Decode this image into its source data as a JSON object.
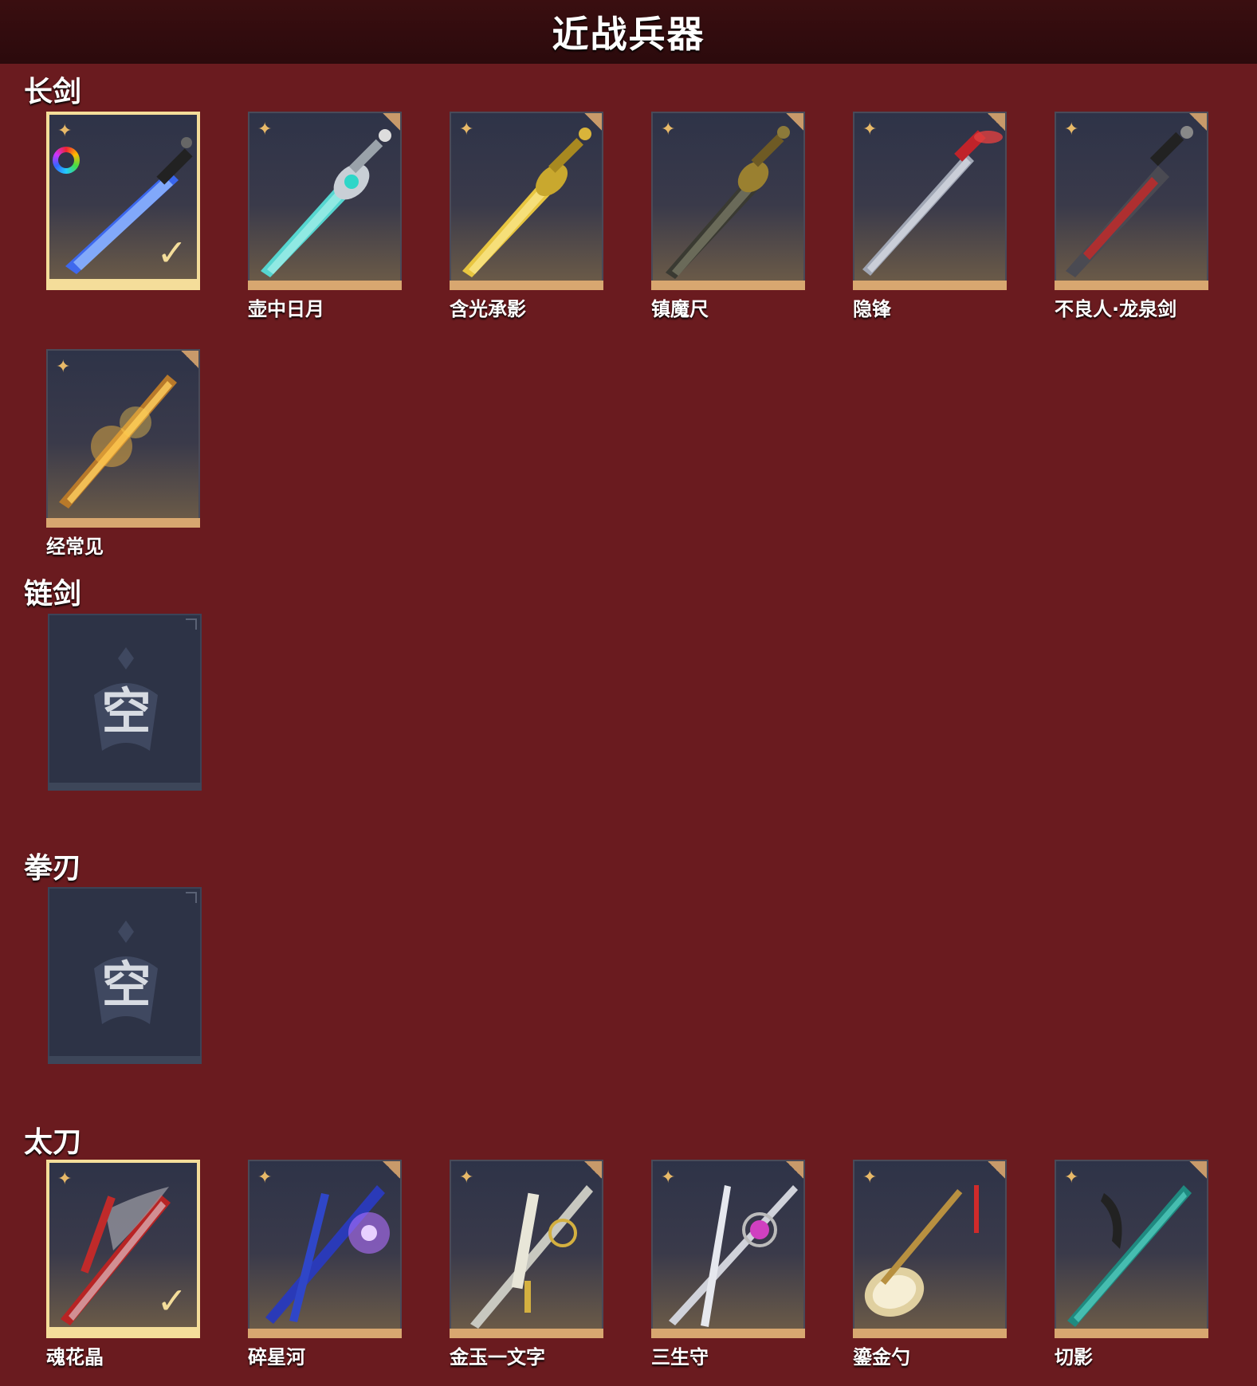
{
  "header": {
    "title": "近战兵器"
  },
  "sections": {
    "longsword": {
      "title": "长剑"
    },
    "chainsword": {
      "title": "链剑"
    },
    "fistblade": {
      "title": "拳刃"
    },
    "tachi": {
      "title": "太刀"
    }
  },
  "longsword_items": [
    {
      "label": "",
      "selected": true
    },
    {
      "label": "壶中日月"
    },
    {
      "label": "含光承影"
    },
    {
      "label": "镇魔尺"
    },
    {
      "label": "隐锋"
    },
    {
      "label": "不良人·龙泉剑"
    },
    {
      "label": "经常见"
    }
  ],
  "chainsword_items": [
    {
      "empty_text": "空"
    }
  ],
  "fistblade_items": [
    {
      "empty_text": "空"
    }
  ],
  "tachi_items": [
    {
      "label": "魂花晶",
      "selected": true
    },
    {
      "label": "碎星河"
    },
    {
      "label": "金玉一文字"
    },
    {
      "label": "三生守"
    },
    {
      "label": "鎏金勺"
    },
    {
      "label": "切影"
    }
  ],
  "icons": {
    "star": "✦",
    "check": "✓"
  },
  "colors": {
    "background": "#6a1b1f",
    "header": "#2b0a0c",
    "selected_border": "#f4dd9a",
    "card_bottom": "#d8a770"
  }
}
